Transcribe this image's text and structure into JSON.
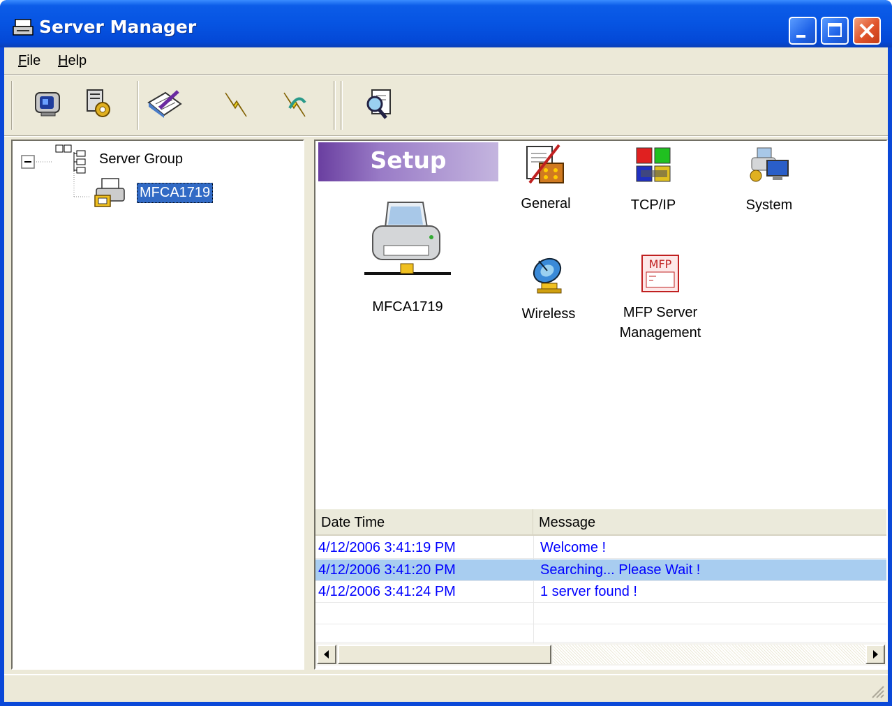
{
  "window": {
    "title": "Server Manager"
  },
  "menu": {
    "file": "File",
    "help": "Help",
    "file_mnemonic": "F",
    "file_rest": "ile",
    "help_mnemonic": "H",
    "help_rest": "elp"
  },
  "toolbar": {
    "buttons": [
      {
        "icon": "monitor-icon"
      },
      {
        "icon": "server-settings-icon"
      },
      {
        "icon": "notepad-pen-icon"
      },
      {
        "icon": "lightning-icon"
      },
      {
        "icon": "lightning-arrow-icon"
      },
      {
        "icon": "search-document-icon"
      }
    ]
  },
  "tree": {
    "root_label": "Server Group",
    "child_label": "MFCA1719"
  },
  "setup": {
    "banner": "Setup",
    "device_label": "MFCA1719",
    "items": {
      "general": "General",
      "tcpip": "TCP/IP",
      "system": "System",
      "wireless": "Wireless",
      "mfp_line1": "MFP Server",
      "mfp_line2": "Management",
      "mfp_badge": "MFP"
    }
  },
  "log": {
    "col_datetime": "Date Time",
    "col_message": "Message",
    "rows": [
      {
        "datetime": "4/12/2006 3:41:19 PM",
        "message": "Welcome !"
      },
      {
        "datetime": "4/12/2006 3:41:20 PM",
        "message": "Searching... Please Wait !"
      },
      {
        "datetime": "4/12/2006 3:41:24 PM",
        "message": "1 server found !"
      }
    ]
  },
  "colors": {
    "titlebar": "#0654e2",
    "selection": "#316ac5",
    "row_highlight": "#a8cdf0",
    "log_text": "#0000ff",
    "setup_banner": "#9a7cc7"
  }
}
